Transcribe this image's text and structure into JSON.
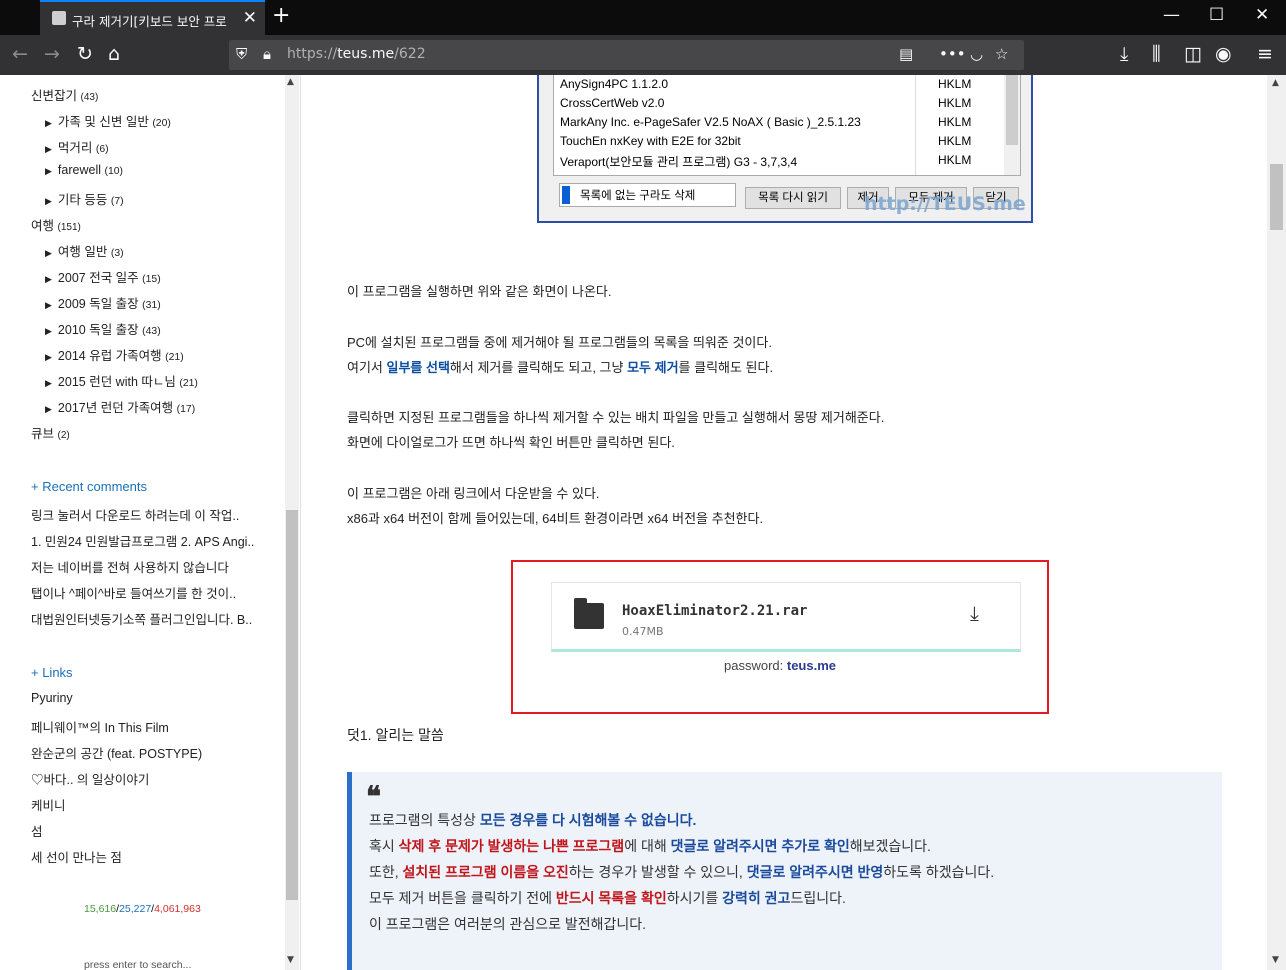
{
  "browser": {
    "tab_title": "구라 제거기[키보드 보안 프로",
    "url_prefix": "https://",
    "url_host": "teus.me",
    "url_path": "/622"
  },
  "sidebar": {
    "categories": [
      {
        "label": "신변잡기",
        "count": "(43)",
        "level": 0
      },
      {
        "label": "가족 및 신변 일반",
        "count": "(20)",
        "level": 1
      },
      {
        "label": "먹거리",
        "count": "(6)",
        "level": 1
      },
      {
        "label": "farewell",
        "count": "(10)",
        "level": 1
      },
      {
        "label": "기타 등등",
        "count": "(7)",
        "level": 1
      },
      {
        "label": "여행",
        "count": "(151)",
        "level": 0
      },
      {
        "label": "여행 일반",
        "count": "(3)",
        "level": 1
      },
      {
        "label": "2007 전국 일주",
        "count": "(15)",
        "level": 1
      },
      {
        "label": "2009 독일 출장",
        "count": "(31)",
        "level": 1
      },
      {
        "label": "2010 독일 출장",
        "count": "(43)",
        "level": 1
      },
      {
        "label": "2014 유럽 가족여행",
        "count": "(21)",
        "level": 1
      },
      {
        "label": "2015 런던 with 따ㄴ님",
        "count": "(21)",
        "level": 1
      },
      {
        "label": "2017년 런던 가족여행",
        "count": "(17)",
        "level": 1
      },
      {
        "label": "큐브",
        "count": "(2)",
        "level": 0
      }
    ],
    "recent_comments_title": "+ Recent comments",
    "recent_comments": [
      "링크 눌러서 다운로드 하려는데 이 작업..",
      "1. 민원24 민원발급프로그램 2. APS Angi..",
      "저는 네이버를 전혀 사용하지 않습니다",
      "탭이나 ^페이^바로 들여쓰기를 한 것이..",
      "대법원인터넷등기소쪽 플러그인입니다. B.."
    ],
    "links_title": "+ Links",
    "links": [
      "Pyuriny",
      "페니웨이™의 In This Film",
      "완순군의 공간 (feat. POSTYPE)",
      "♡바다.. 의 일상이야기",
      "케비니",
      "섬",
      "세 선이 만나는 점"
    ],
    "counter": {
      "today": "15,616",
      "yesterday": "25,227",
      "total": "4,061,963",
      "sep": "/"
    },
    "search_placeholder": "press enter to search..."
  },
  "screenshot": {
    "rows": [
      {
        "name": "AnySign4PC 1.1.2.0",
        "hive": "HKLM"
      },
      {
        "name": "CrossCertWeb v2.0",
        "hive": "HKLM"
      },
      {
        "name": "MarkAny Inc. e-PageSafer V2.5 NoAX ( Basic )_2.5.1.23",
        "hive": "HKLM"
      },
      {
        "name": "TouchEn nxKey with E2E for 32bit",
        "hive": "HKLM"
      },
      {
        "name": "Veraport(보안모듈 관리 프로그램) G3 - 3,7,3,4",
        "hive": "HKLM"
      }
    ],
    "checkbox_label": "목록에 없는 구라도 삭제",
    "btn_reload": "목록 다시 읽기",
    "btn_remove": "제거",
    "btn_remove_all": "모두 제거",
    "btn_close": "닫기",
    "watermark": "http://TEUS.me"
  },
  "article": {
    "p1": "이 프로그램을 실행하면 위와 같은 화면이 나온다.",
    "p2": "PC에 설치된 프로그램들 중에 제거해야 될 프로그램들의 목록을 띄워준 것이다.",
    "p3_a": "여기서 ",
    "p3_b": "일부를 선택",
    "p3_c": "해서 제거를 클릭해도 되고, 그냥 ",
    "p3_d": "모두 제거",
    "p3_e": "를 클릭해도 된다.",
    "p4": "클릭하면 지정된 프로그램들을 하나씩 제거할 수 있는 배치 파일을 만들고 실행해서 몽땅 제거해준다.",
    "p5": "화면에 다이얼로그가 뜨면 하나씩 확인 버튼만 클릭하면 된다.",
    "p6": "이 프로그램은 아래 링크에서 다운받을 수 있다.",
    "p7": "x86과 x64 버전이 함께 들어있는데, 64비트 환경이라면 x64 버전을 추천한다.",
    "file_name": "HoaxEliminator2.21.rar",
    "file_size": "0.47MB",
    "password_label": "password: ",
    "password_value": "teus.me",
    "heading": "덧1. 알리는 말씀",
    "quote": {
      "l1_a": "프로그램의 특성상 ",
      "l1_b": "모든 경우를 다 시험해볼 수 없습니다.",
      "l2_a": "혹시 ",
      "l2_b": "삭제 후 문제가 발생하는 나쁜 프로그램",
      "l2_c": "에 대해 ",
      "l2_d": "댓글로 알려주시면 추가로 확인",
      "l2_e": "해보겠습니다.",
      "l3_a": "또한, ",
      "l3_b": "설치된 프로그램 이름을 오진",
      "l3_c": "하는 경우가 발생할 수 있으니, ",
      "l3_d": "댓글로 알려주시면 반영",
      "l3_e": "하도록 하겠습니다.",
      "l4_a": "모두 제거 버튼을 클릭하기 전에 ",
      "l4_b": "반드시 목록을 확인",
      "l4_c": "하시기를 ",
      "l4_d": "강력히 권고",
      "l4_e": "드립니다.",
      "l5": "이 프로그램은 여러분의 관심으로 발전해갑니다."
    }
  },
  "colors": {
    "accent": "#0a84ff",
    "highlight_blue": "#0b4ea2",
    "highlight_red": "#c0151a",
    "box_red": "#e01b24"
  }
}
